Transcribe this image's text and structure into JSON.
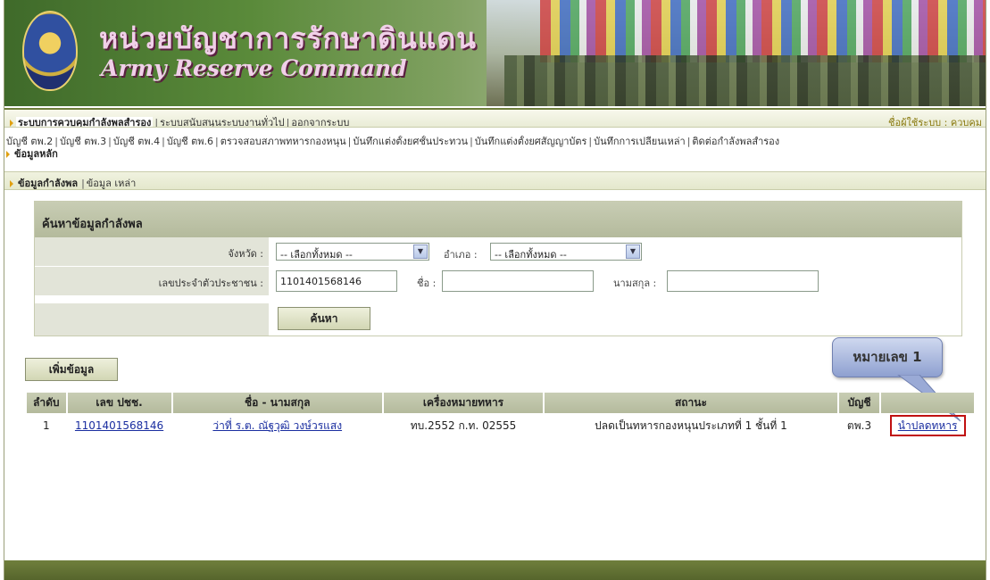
{
  "header": {
    "title_th": "หน่วยบัญชาการรักษาดินแดน",
    "title_en": "Army Reserve Command"
  },
  "top_menu": {
    "items": [
      "ระบบการควบคุมกำลังพลสำรอง",
      "ระบบสนับสนุนระบบงานทั่วไป",
      "ออกจากระบบ"
    ],
    "user_label": "ชื่อผู้ใช้ระบบ : ควบคุม"
  },
  "sub_menu": {
    "items": [
      "บัญชี ตพ.2",
      "บัญชี ตพ.3",
      "บัญชี ตพ.4",
      "บัญชี ตพ.6",
      "ตรวจสอบสภาพทหารกองหนุน",
      "บันทึกแต่งตั้งยศชั้นประทวน",
      "บันทึกแต่งตั้งยศสัญญาบัตร",
      "บันทึกการเปลี่ยนเหล่า",
      "ติดต่อกำลังพลสำรอง"
    ],
    "active": "ข้อมูลหลัก"
  },
  "tabs": {
    "items": [
      "ข้อมูลกำลังพล",
      "ข้อมูล เหล่า"
    ]
  },
  "search": {
    "title": "ค้นหาข้อมูลกำลังพล",
    "province_label": "จังหวัด :",
    "province_value": "-- เลือกทั้งหมด --",
    "district_label": "อำเภอ :",
    "district_value": "-- เลือกทั้งหมด --",
    "id_label": "เลขประจำตัวประชาชน :",
    "id_value": "1101401568146",
    "name_label": "ชื่อ :",
    "name_value": "",
    "surname_label": "นามสกุล :",
    "surname_value": "",
    "search_button": "ค้นหา"
  },
  "add_button": "เพิ่มข้อมูล",
  "callout": "หมายเลข 1",
  "table": {
    "headers": [
      "ลำดับ",
      "เลข ปชช.",
      "ชื่อ - นามสกุล",
      "เครื่องหมายทหาร",
      "สถานะ",
      "บัญชี",
      ""
    ],
    "rows": [
      {
        "no": "1",
        "id": "1101401568146",
        "name": "ว่าที่ ร.ต. ณัฐวุฒิ  วงษ์วรแสง",
        "badge": "ทบ.2552 ก.ท. 02555",
        "status": "ปลดเป็นทหารกองหนุนประเภทที่ 1 ชั้นที่ 1",
        "account": "ตพ.3",
        "action": "นำปลดทหาร"
      }
    ]
  },
  "colors": {
    "header_bar": "#b4ba9c",
    "footer": "#56652c",
    "link": "#1a2ea0",
    "highlight": "#c01010"
  }
}
